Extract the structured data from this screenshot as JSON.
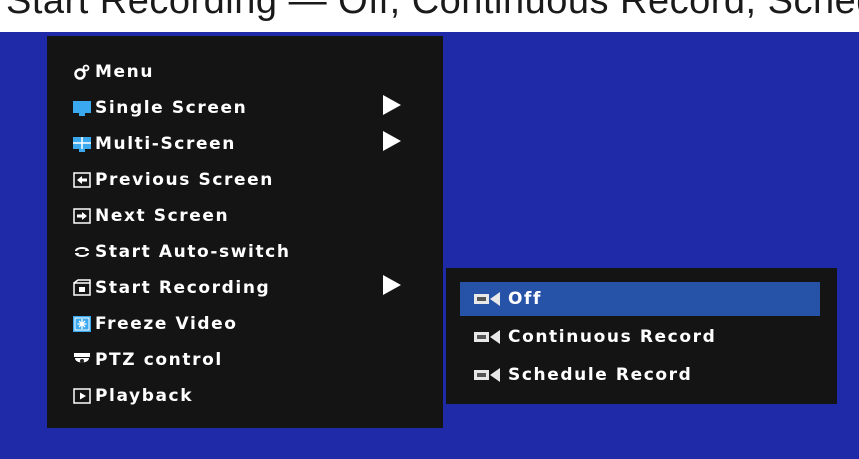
{
  "caption": "Start Recording — Off, Continuous Record, Schedule Record",
  "colors": {
    "screen_bg": "#1f2aa8",
    "menu_bg": "#141414",
    "highlight": "#2652a8"
  },
  "menu": {
    "items": [
      {
        "label": "Menu",
        "icon": "gear-icon",
        "has_submenu": false
      },
      {
        "label": "Single Screen",
        "icon": "monitor-icon",
        "has_submenu": true
      },
      {
        "label": "Multi-Screen",
        "icon": "grid-screen-icon",
        "has_submenu": true
      },
      {
        "label": "Previous Screen",
        "icon": "arrow-left-icon",
        "has_submenu": false
      },
      {
        "label": "Next Screen",
        "icon": "arrow-right-icon",
        "has_submenu": false
      },
      {
        "label": "Start Auto-switch",
        "icon": "cycle-icon",
        "has_submenu": false
      },
      {
        "label": "Start Recording",
        "icon": "record-icon",
        "has_submenu": true
      },
      {
        "label": "Freeze Video",
        "icon": "freeze-icon",
        "has_submenu": false
      },
      {
        "label": "PTZ control",
        "icon": "dome-camera-icon",
        "has_submenu": false
      },
      {
        "label": "Playback",
        "icon": "playback-icon",
        "has_submenu": false
      }
    ]
  },
  "submenu": {
    "items": [
      {
        "label": "Off",
        "icon": "camera-icon",
        "selected": true
      },
      {
        "label": "Continuous Record",
        "icon": "camera-icon",
        "selected": false
      },
      {
        "label": "Schedule Record",
        "icon": "camera-icon",
        "selected": false
      }
    ]
  }
}
